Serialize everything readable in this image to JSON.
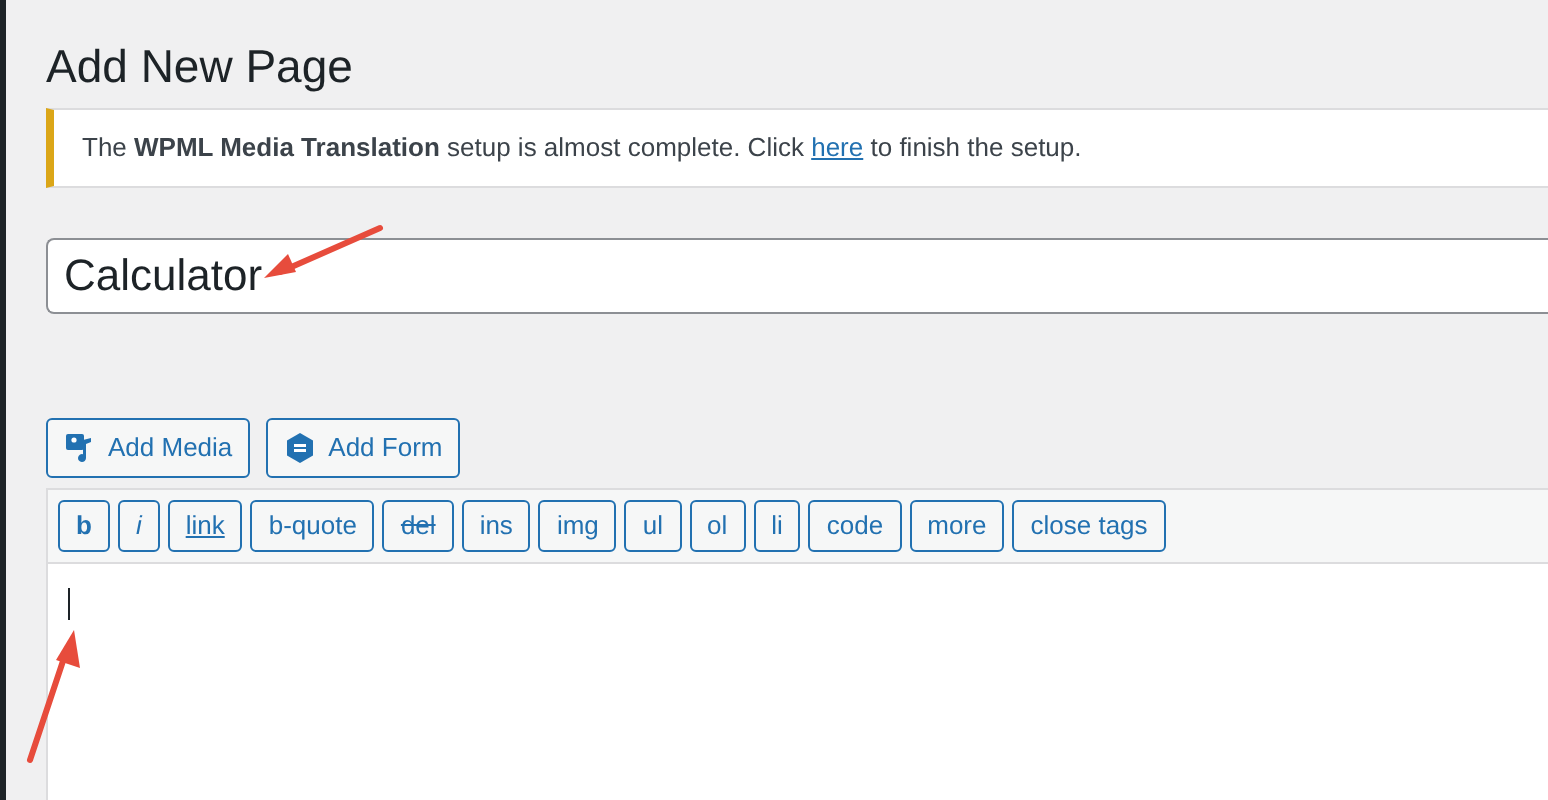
{
  "page_title": "Add New Page",
  "notice": {
    "text": "The **WPML Media Translation** setup is almost complete. Click ",
    "link": "here",
    "after": " to finish the setup."
  },
  "title_field": {
    "value": "Calculator"
  },
  "media_buttons": [
    {
      "label": "Add Media",
      "kind": "media"
    },
    {
      "label": "Add Form",
      "kind": "form"
    }
  ],
  "quicktags": [
    {
      "label": "b",
      "kind": "bold"
    },
    {
      "label": "i",
      "kind": "italic"
    },
    {
      "label": "link",
      "kind": "underline"
    },
    {
      "label": "b-quote",
      "kind": "plain"
    },
    {
      "label": "del",
      "kind": "strike"
    },
    {
      "label": "ins",
      "kind": "plain"
    },
    {
      "label": "img",
      "kind": "plain"
    },
    {
      "label": "ul",
      "kind": "plain"
    },
    {
      "label": "ol",
      "kind": "plain"
    },
    {
      "label": "li",
      "kind": "plain"
    },
    {
      "label": "code",
      "kind": "plain"
    },
    {
      "label": "more",
      "kind": "plain"
    },
    {
      "label": "close tags",
      "kind": "plain"
    }
  ]
}
